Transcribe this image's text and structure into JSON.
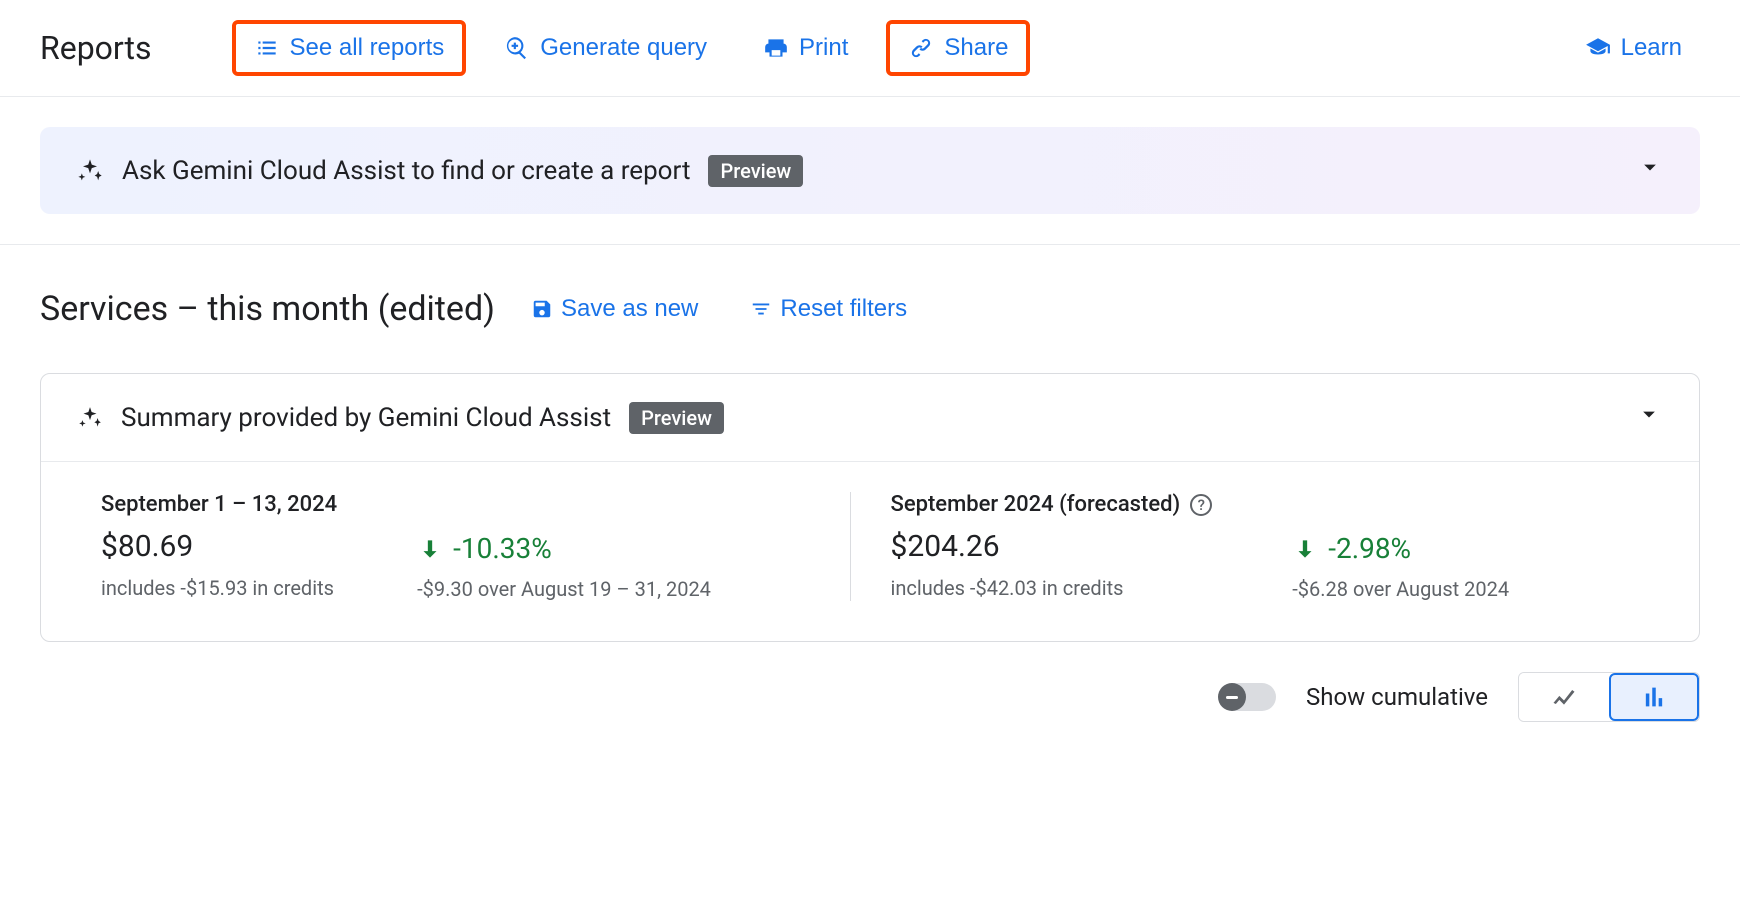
{
  "header": {
    "title": "Reports",
    "see_all": "See all reports",
    "generate_query": "Generate query",
    "print": "Print",
    "share": "Share",
    "learn": "Learn"
  },
  "gemini_banner": {
    "text": "Ask Gemini Cloud Assist to find or create a report",
    "badge": "Preview"
  },
  "report": {
    "title": "Services – this month (edited)",
    "save_as_new": "Save as new",
    "reset_filters": "Reset filters"
  },
  "summary_card": {
    "header": "Summary provided by Gemini Cloud Assist",
    "badge": "Preview",
    "left": {
      "period": "September 1 – 13, 2024",
      "amount": "$80.69",
      "credits": "includes -$15.93 in credits",
      "delta_pct": "-10.33%",
      "delta_sub": "-$9.30 over August 19 – 31, 2024"
    },
    "right": {
      "period": "September 2024 (forecasted)",
      "amount": "$204.26",
      "credits": "includes -$42.03 in credits",
      "delta_pct": "-2.98%",
      "delta_sub": "-$6.28 over August 2024"
    }
  },
  "footer": {
    "toggle_label": "Show cumulative"
  }
}
